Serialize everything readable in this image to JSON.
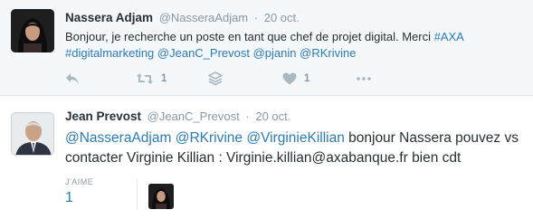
{
  "tweets": [
    {
      "author_name": "Nassera Adjam",
      "handle": "@NasseraAdjam",
      "separator": "·",
      "time": "20 oct.",
      "text_plain": "Bonjour, je recherche un poste en tant que chef de projet digital. Merci ",
      "tag_axa": "#AXA",
      "tag_digital": "#digitalmarketing",
      "mention_jeanc": "@JeanC_Prevost",
      "mention_pjanin": "@pjanin",
      "mention_rkrivine": "@RKrivine",
      "retweet_count": "1",
      "like_count": "1",
      "icons": [
        "reply-icon",
        "retweet-icon",
        "stack-icon",
        "heart-icon",
        "more-icon"
      ]
    },
    {
      "author_name": "Jean Prevost",
      "handle": "@JeanC_Prevost",
      "separator": "·",
      "time": "20 oct.",
      "mention_nassera": "@NasseraAdjam",
      "mention_rkrivine": "@RKrivine",
      "mention_virginie": "@VirginieKillian",
      "text_plain": " bonjour Nassera pouvez vs contacter Virginie Killian : Virginie.killian@axabanque.fr bien cdt",
      "likes_label": "J'AIME",
      "likes_value": "1"
    }
  ],
  "colors": {
    "link": "#2b7bb9",
    "text": "#292f33",
    "muted": "#8899a6",
    "icon": "#aab8c2",
    "highlight_bg": "#f5f8fa"
  }
}
